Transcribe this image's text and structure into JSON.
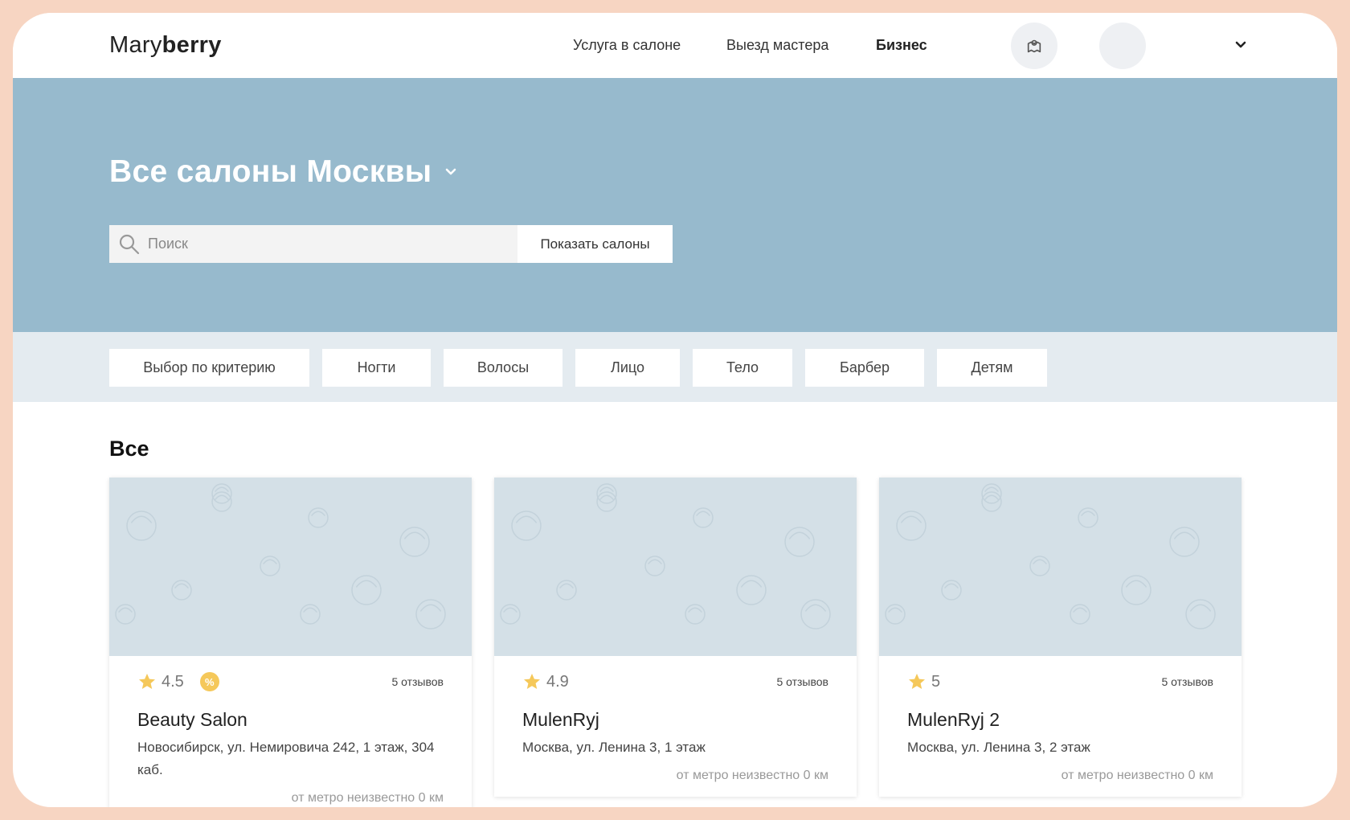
{
  "header": {
    "logo_light": "Mary",
    "logo_bold": "berry",
    "nav": [
      {
        "label": "Услуга в салоне"
      },
      {
        "label": "Выезд мастера"
      },
      {
        "label": "Бизнес"
      }
    ]
  },
  "hero": {
    "title": "Все салоны Москвы",
    "search_placeholder": "Поиск",
    "search_button": "Показать салоны"
  },
  "filters": [
    {
      "label": "Выбор по критерию"
    },
    {
      "label": "Ногти"
    },
    {
      "label": "Волосы"
    },
    {
      "label": "Лицо"
    },
    {
      "label": "Тело"
    },
    {
      "label": "Барбер"
    },
    {
      "label": "Детям"
    }
  ],
  "section": {
    "title": "Все"
  },
  "cards": [
    {
      "rating": "4.5",
      "badge": "%",
      "reviews": "5 отзывов",
      "name": "Beauty Salon",
      "address": "Новосибирск, ул. Немировича 242, 1 этаж, 304 каб.",
      "metro": "от метро неизвестно 0 км"
    },
    {
      "rating": "4.9",
      "reviews": "5 отзывов",
      "name": "MulenRyj",
      "address": "Москва, ул. Ленина 3, 1 этаж",
      "metro": "от метро неизвестно 0 км"
    },
    {
      "rating": "5",
      "reviews": "5 отзывов",
      "name": "MulenRyj 2",
      "address": "Москва, ул. Ленина 3, 2 этаж",
      "metro": "от метро неизвестно 0 км"
    }
  ],
  "colors": {
    "frame": "#f7d5c2",
    "hero": "#97bacd",
    "filter_strip": "#e4ebf0",
    "card_image": "#d4e0e7",
    "star": "#f5c85a"
  }
}
